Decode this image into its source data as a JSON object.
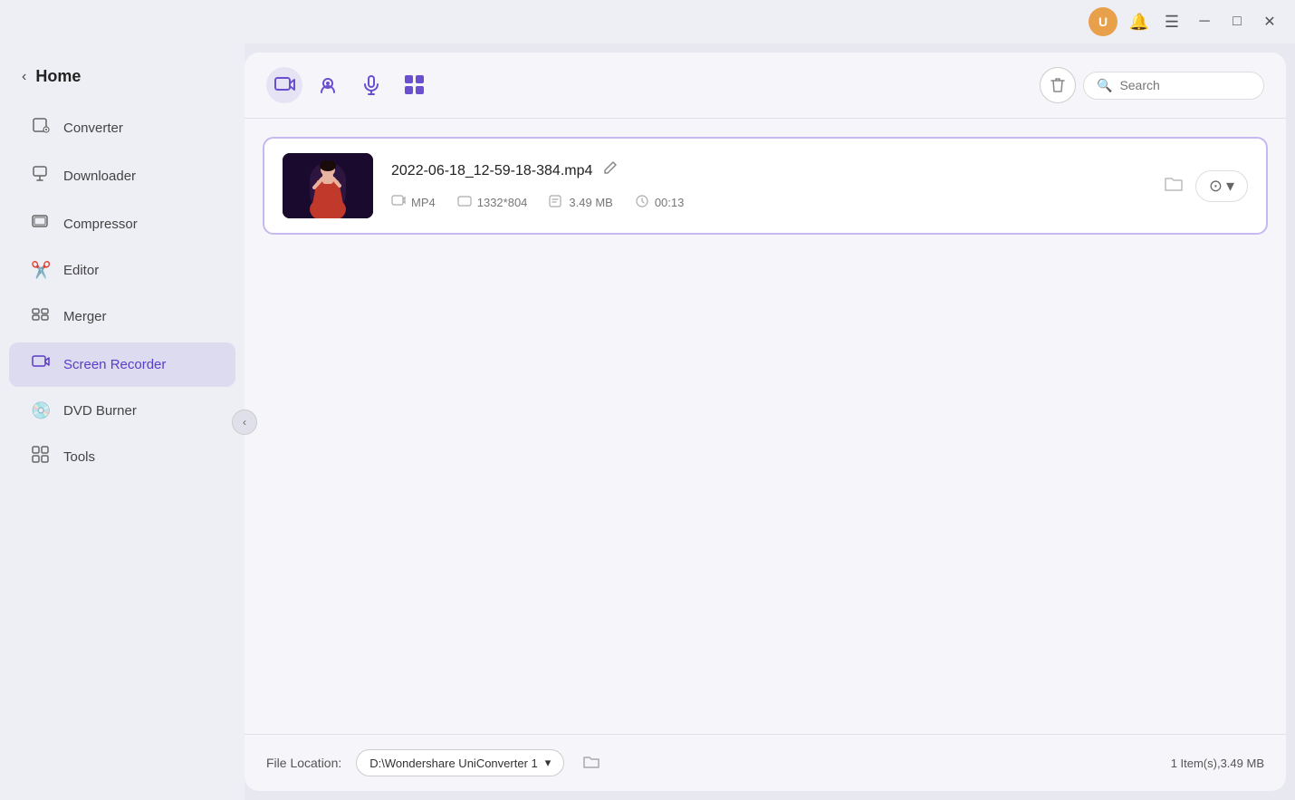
{
  "titlebar": {
    "avatar_initial": "U",
    "icons": [
      "bell-icon",
      "menu-icon",
      "minimize-icon",
      "maximize-icon",
      "close-icon"
    ]
  },
  "sidebar": {
    "home_label": "Home",
    "items": [
      {
        "id": "converter",
        "label": "Converter",
        "icon": "🖥"
      },
      {
        "id": "downloader",
        "label": "Downloader",
        "icon": "⬇"
      },
      {
        "id": "compressor",
        "label": "Compressor",
        "icon": "📼"
      },
      {
        "id": "editor",
        "label": "Editor",
        "icon": "✂"
      },
      {
        "id": "merger",
        "label": "Merger",
        "icon": "🔗"
      },
      {
        "id": "screen-recorder",
        "label": "Screen Recorder",
        "icon": "🎬"
      },
      {
        "id": "dvd-burner",
        "label": "DVD Burner",
        "icon": "💿"
      },
      {
        "id": "tools",
        "label": "Tools",
        "icon": "🔧"
      }
    ]
  },
  "toolbar": {
    "buttons": [
      {
        "id": "screen-record",
        "label": "Screen Record"
      },
      {
        "id": "webcam",
        "label": "Webcam"
      },
      {
        "id": "audio",
        "label": "Audio"
      },
      {
        "id": "snapshots",
        "label": "Snapshots"
      }
    ],
    "search_placeholder": "Search",
    "trash_label": "Delete"
  },
  "file_item": {
    "filename": "2022-06-18_12-59-18-384.mp4",
    "format": "MP4",
    "resolution": "1332*804",
    "size": "3.49 MB",
    "duration": "00:13"
  },
  "footer": {
    "file_location_label": "File Location:",
    "location_path": "D:\\Wondershare UniConverter 1",
    "count_label": "1 Item(s),3.49 MB"
  }
}
